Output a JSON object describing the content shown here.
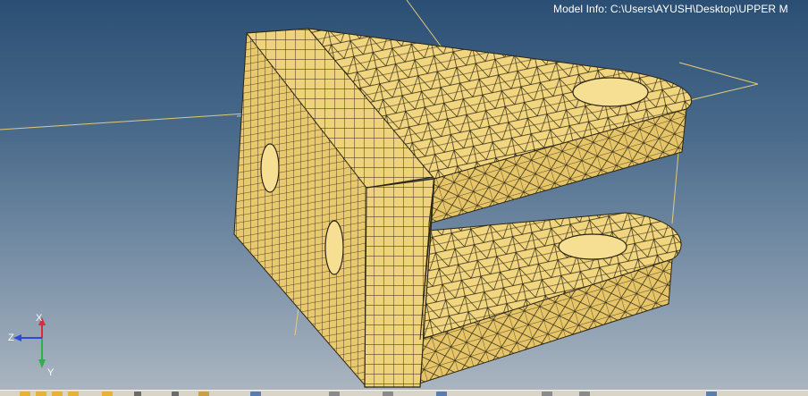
{
  "window": {
    "model_info": "Model Info: C:\\Users\\AYUSH\\Desktop\\UPPER M"
  },
  "triad": {
    "x_label": "X",
    "y_label": "Y",
    "z_label": "Z"
  },
  "colors": {
    "mesh_fill": "#f0d27a",
    "mesh_fill_dark": "#d8b45a",
    "mesh_line": "#2a2410",
    "background_top": "#2b4f74",
    "background_bottom": "#aab5c0",
    "axis_x": "#e0283a",
    "axis_y": "#2bb34a",
    "axis_z": "#2f4bd6"
  },
  "toolbar": {
    "icons": [
      "folder-open-icon",
      "folder-icon",
      "folder-icon",
      "folder-icon",
      "save-icon",
      "undo-icon",
      "redo-icon",
      "pointer-icon",
      "rotate-icon",
      "zoom-icon",
      "pan-icon",
      "fit-icon",
      "view-icon",
      "shade-icon",
      "mesh-icon"
    ]
  }
}
